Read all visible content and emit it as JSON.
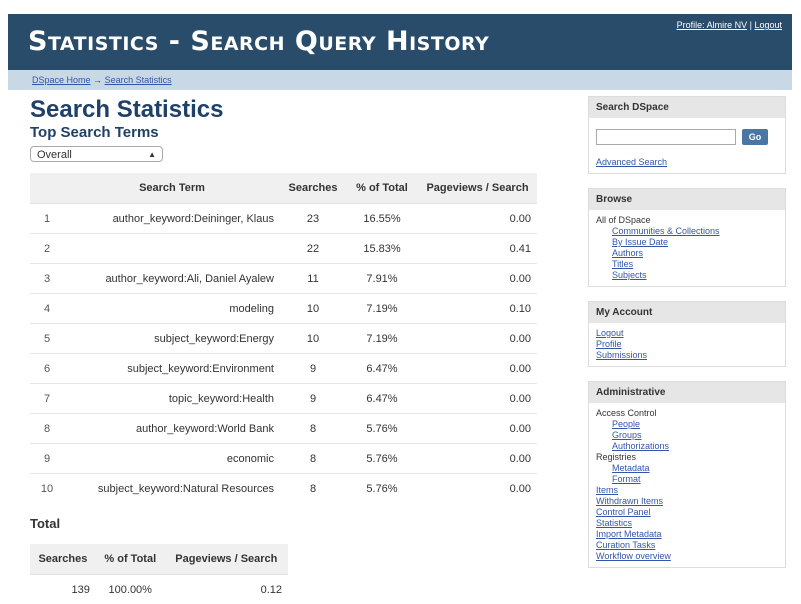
{
  "header": {
    "title": "Statistics - Search Query History",
    "profile_link": "Profile: Almire NV",
    "separator": "|",
    "logout_link": "Logout"
  },
  "trail": {
    "home": "DSpace Home",
    "arrow": "→",
    "current": "Search Statistics"
  },
  "main": {
    "heading": "Search Statistics",
    "subheading": "Top Search Terms",
    "period_select": "Overall",
    "columns": [
      "",
      "Search Term",
      "Searches",
      "% of Total",
      "Pageviews / Search"
    ],
    "rows": [
      {
        "idx": "1",
        "term": "author_keyword:Deininger, Klaus",
        "searches": "23",
        "pct": "16.55%",
        "pv": "0.00"
      },
      {
        "idx": "2",
        "term": "",
        "searches": "22",
        "pct": "15.83%",
        "pv": "0.41"
      },
      {
        "idx": "3",
        "term": "author_keyword:Ali, Daniel Ayalew",
        "searches": "11",
        "pct": "7.91%",
        "pv": "0.00"
      },
      {
        "idx": "4",
        "term": "modeling",
        "searches": "10",
        "pct": "7.19%",
        "pv": "0.10"
      },
      {
        "idx": "5",
        "term": "subject_keyword:Energy",
        "searches": "10",
        "pct": "7.19%",
        "pv": "0.00"
      },
      {
        "idx": "6",
        "term": "subject_keyword:Environment",
        "searches": "9",
        "pct": "6.47%",
        "pv": "0.00"
      },
      {
        "idx": "7",
        "term": "topic_keyword:Health",
        "searches": "9",
        "pct": "6.47%",
        "pv": "0.00"
      },
      {
        "idx": "8",
        "term": "author_keyword:World Bank",
        "searches": "8",
        "pct": "5.76%",
        "pv": "0.00"
      },
      {
        "idx": "9",
        "term": "economic",
        "searches": "8",
        "pct": "5.76%",
        "pv": "0.00"
      },
      {
        "idx": "10",
        "term": "subject_keyword:Natural Resources",
        "searches": "8",
        "pct": "5.76%",
        "pv": "0.00"
      }
    ],
    "total_label": "Total",
    "total_columns": [
      "Searches",
      "% of Total",
      "Pageviews / Search"
    ],
    "total_row": {
      "searches": "139",
      "pct": "100.00%",
      "pv": "0.12"
    }
  },
  "sidebar": {
    "search": {
      "title": "Search DSpace",
      "go": "Go",
      "advanced": "Advanced Search"
    },
    "browse": {
      "title": "Browse",
      "scope": "All of DSpace",
      "links": [
        "Communities & Collections",
        "By Issue Date",
        "Authors",
        "Titles",
        "Subjects"
      ]
    },
    "account": {
      "title": "My Account",
      "links": [
        "Logout",
        "Profile",
        "Submissions"
      ]
    },
    "admin": {
      "title": "Administrative",
      "access_control": "Access Control",
      "access_links": [
        "People",
        "Groups",
        "Authorizations"
      ],
      "registries": "Registries",
      "registry_links": [
        "Metadata",
        "Format"
      ],
      "links": [
        "Items",
        "Withdrawn Items",
        "Control Panel",
        "Statistics",
        "Import Metadata",
        "Curation Tasks",
        "Workflow overview"
      ]
    }
  }
}
